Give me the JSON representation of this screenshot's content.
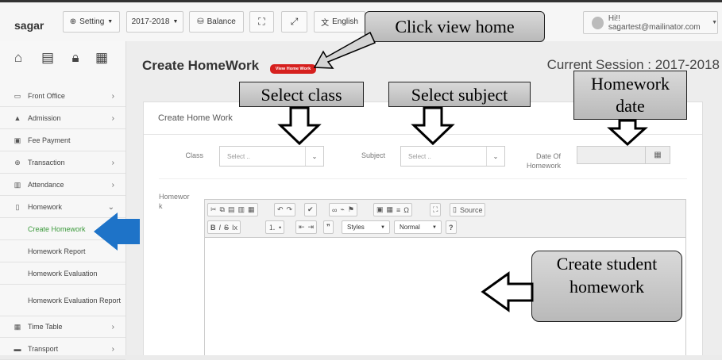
{
  "topbar": {
    "brand": "sagar",
    "setting_label": "Setting",
    "session_label": "2017-2018",
    "balance_label": "Balance",
    "language_label": "English",
    "user_label": "Hi!! sagartest@mailinator.com"
  },
  "sidebar": {
    "items": [
      {
        "label": "Front Office",
        "icon": "desktop-icon"
      },
      {
        "label": "Admission",
        "icon": "graduation-cap-icon"
      },
      {
        "label": "Fee Payment",
        "icon": "money-icon"
      },
      {
        "label": "Transaction",
        "icon": "globe-icon"
      },
      {
        "label": "Attendance",
        "icon": "bar-chart-icon"
      },
      {
        "label": "Homework",
        "icon": "file-icon"
      },
      {
        "label": "Time Table",
        "icon": "calendar-icon"
      },
      {
        "label": "Transport",
        "icon": "bus-icon"
      }
    ],
    "homework_sub": [
      {
        "label": "Create Homework"
      },
      {
        "label": "Homework Report"
      },
      {
        "label": "Homework Evaluation"
      },
      {
        "label": "Homework Evaluation Report"
      }
    ]
  },
  "page": {
    "title": "Create HomeWork",
    "badge": "View Home Work",
    "session": "Current Session : 2017-2018"
  },
  "form": {
    "panel_title": "Create Home Work",
    "class_label": "Class",
    "class_placeholder": "Select ..",
    "subject_label": "Subject",
    "subject_placeholder": "Select ..",
    "date_label": "Date Of Homework",
    "homework_label": "Homework"
  },
  "editor": {
    "source_label": "Source",
    "styles_label": "Styles",
    "format_label": "Normal"
  },
  "callouts": {
    "view_home": "Click view home",
    "select_class": "Select class",
    "select_subject": "Select subject",
    "homework_date": "Homework date",
    "create_student": "Create student homework"
  },
  "colors": {
    "accent_green": "#3c9a3c",
    "badge_red": "#d6201e",
    "arrow_blue": "#1e73c8"
  }
}
